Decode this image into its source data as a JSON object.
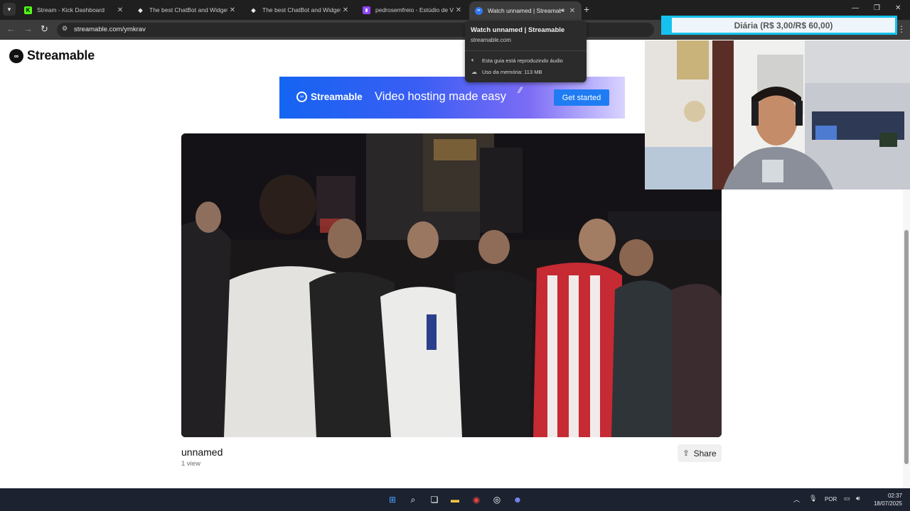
{
  "browser": {
    "tabs": [
      {
        "title": "Stream - Kick Dashboard",
        "favicon": "kick-icon"
      },
      {
        "title": "The best ChatBot and Widgets",
        "favicon": "streamelements-icon"
      },
      {
        "title": "The best ChatBot and Widgets",
        "favicon": "streamelements-icon"
      },
      {
        "title": "pedrosemfreio - Estúdio de Víd",
        "favicon": "twitch-icon"
      },
      {
        "title": "Watch unnamed | Streamable",
        "favicon": "streamable-icon",
        "active": true
      }
    ],
    "url": "streamable.com/ymkrav"
  },
  "tooltip": {
    "title": "Watch unnamed | Streamable",
    "host": "streamable.com",
    "audio_note": "Esta guia está reproduzindo áudio",
    "memory": "Uso da memória: 113 MB"
  },
  "overlay": {
    "goal_text": "Diária (R$ 3,00/R$ 60,00)"
  },
  "page": {
    "logo_text": "Streamable",
    "banner": {
      "brand": "Streamable",
      "tagline": "Video hosting made easy",
      "cta": "Get started"
    },
    "video": {
      "title": "unnamed",
      "views": "1 view",
      "share_label": "Share"
    }
  },
  "taskbar": {
    "language": "POR",
    "time": "02:37",
    "date": "18/07/2025"
  },
  "colors": {
    "accent": "#1f7cf3",
    "goal_bar": "#15c2ee",
    "tab_strip": "#1f1f1f"
  }
}
